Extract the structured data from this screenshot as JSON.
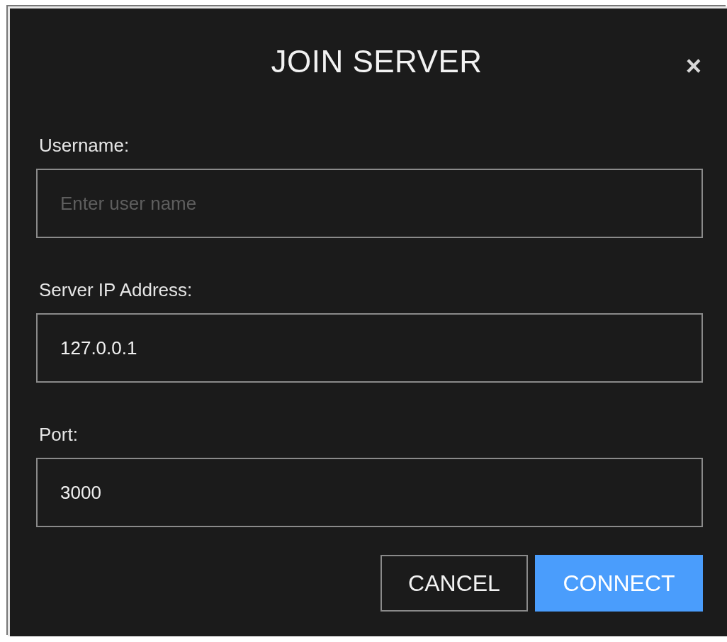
{
  "dialog": {
    "title": "JOIN SERVER",
    "close": "×"
  },
  "fields": [
    {
      "label": "Username:",
      "placeholder": "Enter user name"
    },
    {
      "label": "Server IP Address:",
      "value": "127.0.0.1"
    },
    {
      "label": "Port:",
      "value": "3000"
    }
  ],
  "buttons": [
    {
      "label": "CANCEL",
      "kind": "secondary"
    },
    {
      "label": "CONNECT",
      "kind": "primary"
    }
  ]
}
